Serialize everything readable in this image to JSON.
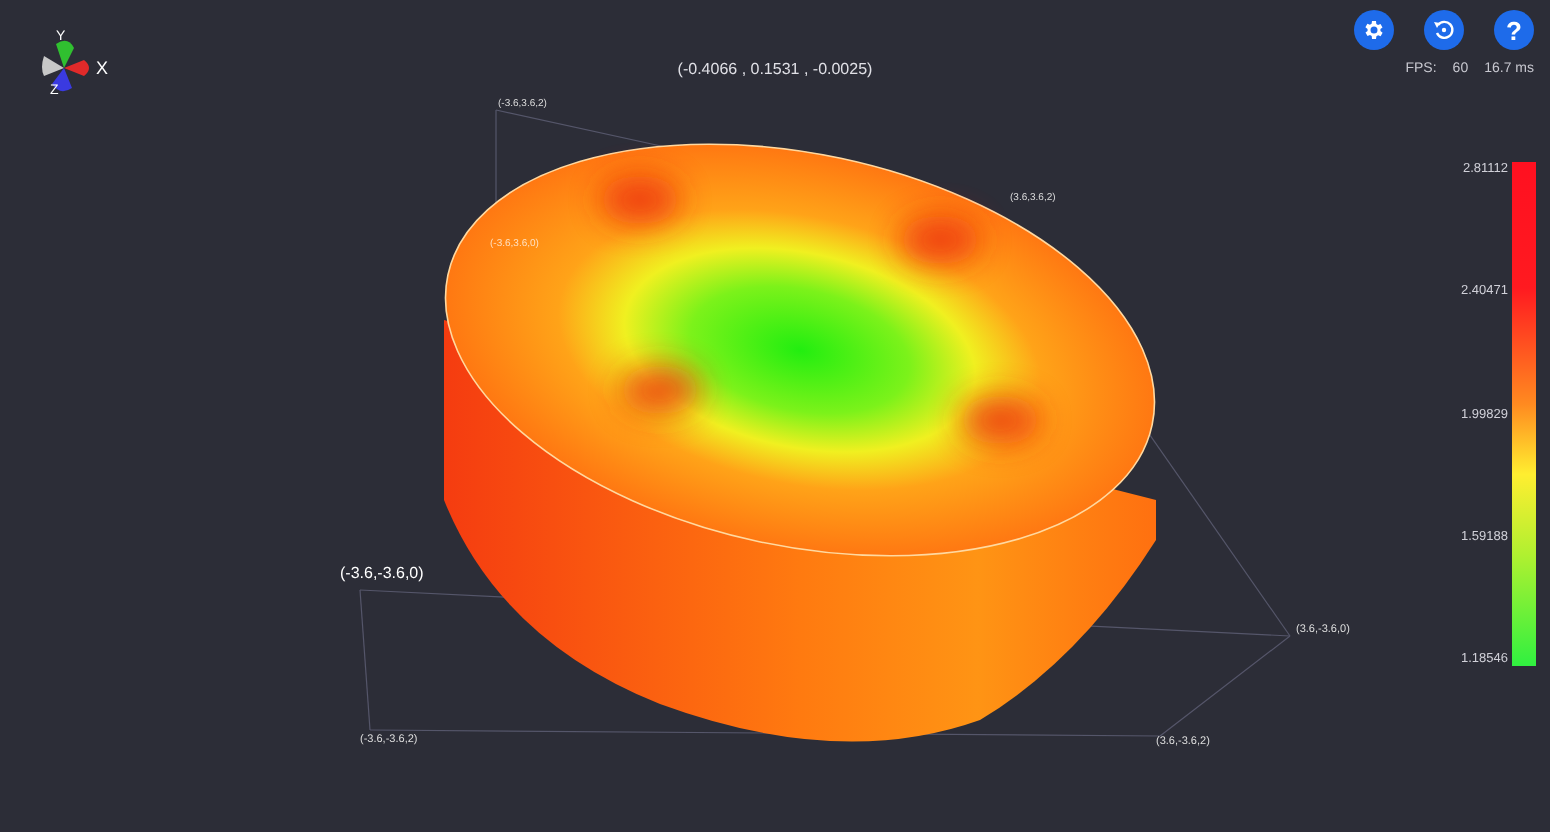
{
  "coordinates": "(-0.4066 , 0.1531 , -0.0025)",
  "gizmo_labels": [
    "X",
    "Y",
    "Z"
  ],
  "toolbar": [
    {
      "kind": "settings"
    },
    {
      "kind": "reset"
    },
    {
      "kind": "help",
      "label": "?"
    }
  ],
  "stats": {
    "fps_label": "FPS:",
    "fps": "60",
    "frame_time": "16.7 ms"
  },
  "legend": {
    "values": [
      "2.81112",
      "2.40471",
      "1.99829",
      "1.59188",
      "1.18546"
    ]
  },
  "corner_labels": [
    "(-3.6,3.6,2)",
    "(3.6,3.6,2)",
    "(-3.6,3.6,0)",
    "(-3.6,-3.6,0)",
    "(3.6,-3.6,0)",
    "(-3.6,-3.6,2)",
    "(3.6,-3.6,2)"
  ]
}
